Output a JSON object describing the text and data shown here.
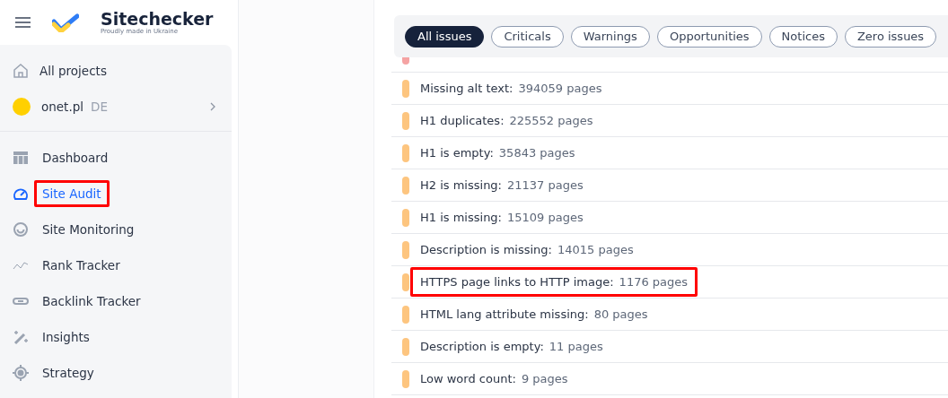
{
  "brand": {
    "name": "Sitechecker",
    "tagline": "Proudly made in Ukraine"
  },
  "project_nav": [
    {
      "kind": "home",
      "label": "All projects"
    },
    {
      "kind": "project",
      "label": "onet.pl",
      "tag": "DE"
    }
  ],
  "nav": [
    {
      "kind": "dashboard",
      "label": "Dashboard",
      "selected": false,
      "highlighted": false
    },
    {
      "kind": "gauge",
      "label": "Site Audit",
      "selected": true,
      "highlighted": true
    },
    {
      "kind": "radar",
      "label": "Site Monitoring",
      "selected": false,
      "highlighted": false
    },
    {
      "kind": "trend",
      "label": "Rank Tracker",
      "selected": false,
      "highlighted": false
    },
    {
      "kind": "link",
      "label": "Backlink Tracker",
      "selected": false,
      "highlighted": false
    },
    {
      "kind": "wand",
      "label": "Insights",
      "selected": false,
      "highlighted": false
    },
    {
      "kind": "target",
      "label": "Strategy",
      "selected": false,
      "highlighted": false
    }
  ],
  "filters": [
    {
      "label": "All issues",
      "selected": true
    },
    {
      "label": "Criticals",
      "selected": false
    },
    {
      "label": "Warnings",
      "selected": false
    },
    {
      "label": "Opportunities",
      "selected": false
    },
    {
      "label": "Notices",
      "selected": false
    },
    {
      "label": "Zero issues",
      "selected": false
    }
  ],
  "covered_issue": {
    "color": "#f5a3a3"
  },
  "issues": [
    {
      "name": "Missing alt text:",
      "count": "394059 pages",
      "color": "#fdc57f",
      "highlighted": false
    },
    {
      "name": "H1 duplicates:",
      "count": "225552 pages",
      "color": "#fdc57f",
      "highlighted": false
    },
    {
      "name": "H1 is empty:",
      "count": "35843 pages",
      "color": "#fdc57f",
      "highlighted": false
    },
    {
      "name": "H2 is missing:",
      "count": "21137 pages",
      "color": "#fdc57f",
      "highlighted": false
    },
    {
      "name": "H1 is missing:",
      "count": "15109 pages",
      "color": "#fdc57f",
      "highlighted": false
    },
    {
      "name": "Description is missing:",
      "count": "14015 pages",
      "color": "#fdc57f",
      "highlighted": false
    },
    {
      "name": "HTTPS page links to HTTP image:",
      "count": "1176 pages",
      "color": "#fdc57f",
      "highlighted": true
    },
    {
      "name": "HTML lang attribute missing:",
      "count": "80 pages",
      "color": "#fdc57f",
      "highlighted": false
    },
    {
      "name": "Description is empty:",
      "count": "11 pages",
      "color": "#fdc57f",
      "highlighted": false
    },
    {
      "name": "Low word count:",
      "count": "9 pages",
      "color": "#fdc57f",
      "highlighted": false
    }
  ]
}
